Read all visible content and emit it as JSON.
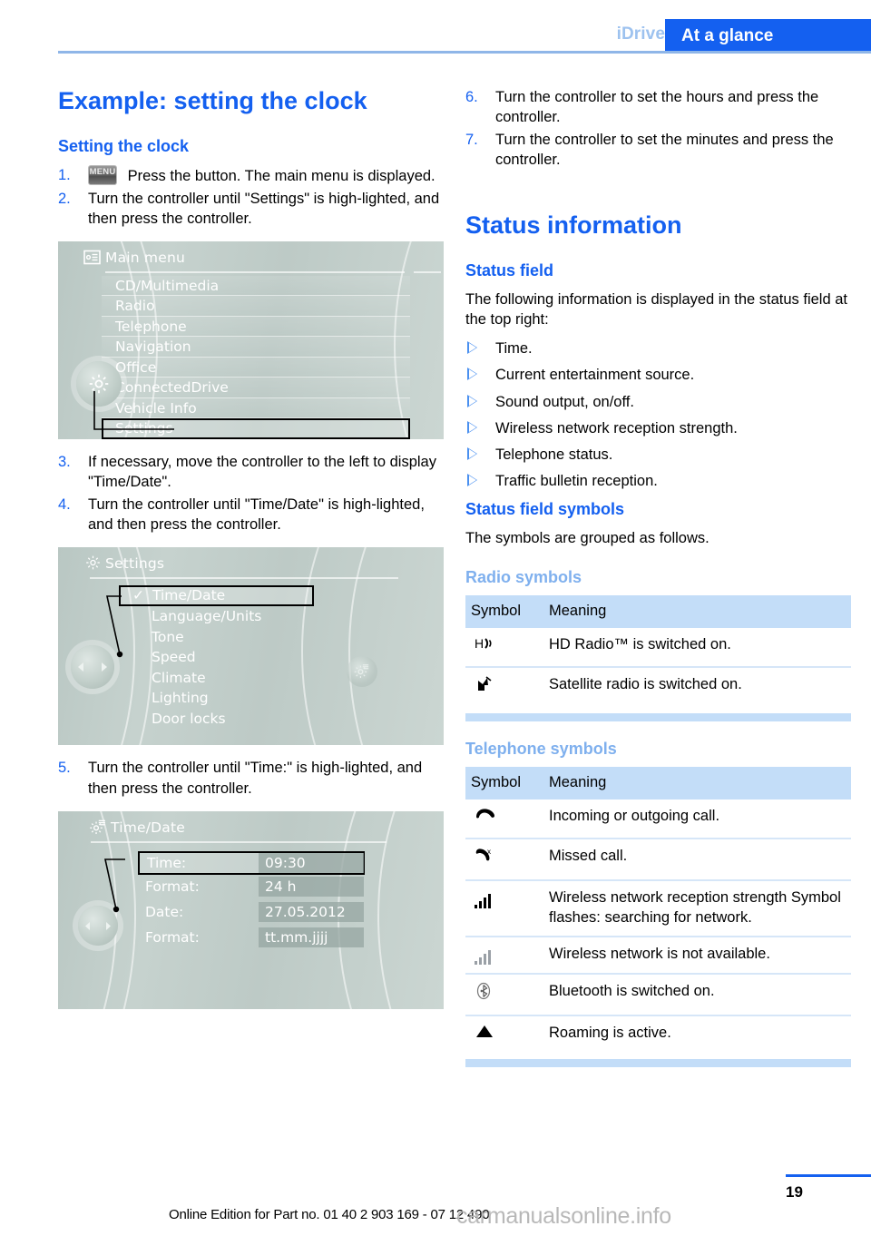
{
  "header": {
    "chapter": "iDrive",
    "section": "At a glance"
  },
  "left": {
    "title": "Example: setting the clock",
    "subheading": "Setting the clock",
    "steps": [
      {
        "num": "1.",
        "icon": "MENU",
        "text": "Press the button. The main menu is displayed."
      },
      {
        "num": "2.",
        "text": "Turn the controller until \"Settings\" is high-lighted, and then press the controller."
      },
      {
        "num": "3.",
        "text": "If necessary, move the controller to the left to display \"Time/Date\"."
      },
      {
        "num": "4.",
        "text": "Turn the controller until \"Time/Date\" is high-lighted, and then press the controller."
      },
      {
        "num": "5.",
        "text": "Turn the controller until \"Time:\" is high-lighted, and then press the controller."
      }
    ],
    "screen_main_menu": {
      "title": "Main menu",
      "title_icon": "list-card-icon",
      "knob_icon": "gear-icon",
      "items": [
        "CD/Multimedia",
        "Radio",
        "Telephone",
        "Navigation",
        "Office",
        "ConnectedDrive",
        "Vehicle Info",
        "Settings"
      ],
      "selected": "Settings"
    },
    "screen_settings": {
      "title": "Settings",
      "title_icon": "gear-icon",
      "knob_icon": "left-right-arrows-icon",
      "side_icon": "settings-gear-icon",
      "check_mark": "✓",
      "items": [
        "Time/Date",
        "Language/Units",
        "Tone",
        "Speed",
        "Climate",
        "Lighting",
        "Door locks"
      ],
      "selected": "Time/Date"
    },
    "screen_time_date": {
      "title": "Time/Date",
      "title_icon": "settings-gear-icon",
      "knob_icon": "left-right-arrows-icon",
      "rows": [
        {
          "label": "Time:",
          "value": "09:30",
          "selected": true
        },
        {
          "label": "Format:",
          "value": "24 h",
          "selected": false
        },
        {
          "label": "Date:",
          "value": "27.05.2012",
          "selected": false
        },
        {
          "label": "Format:",
          "value": "tt.mm.jjjj",
          "selected": false
        }
      ]
    }
  },
  "right": {
    "steps": [
      {
        "num": "6.",
        "text": "Turn the controller to set the hours and press the controller."
      },
      {
        "num": "7.",
        "text": "Turn the controller to set the minutes and press the controller."
      }
    ],
    "title": "Status information",
    "status_field": {
      "heading": "Status field",
      "intro": "The following information is displayed in the status field at the top right:",
      "bullets": [
        "Time.",
        "Current entertainment source.",
        "Sound output, on/off.",
        "Wireless network reception strength.",
        "Telephone status.",
        "Traffic bulletin reception."
      ]
    },
    "status_symbols": {
      "heading": "Status field symbols",
      "intro": "The symbols are grouped as follows."
    },
    "radio_symbols": {
      "heading": "Radio symbols",
      "columns": [
        "Symbol",
        "Meaning"
      ],
      "rows": [
        {
          "symbol": "hd-radio-icon",
          "glyph": "HD))",
          "meaning": "HD Radio™ is switched on."
        },
        {
          "symbol": "satellite-radio-icon",
          "glyph": "satellite",
          "meaning": "Satellite radio is switched on."
        }
      ]
    },
    "telephone_symbols": {
      "heading": "Telephone symbols",
      "columns": [
        "Symbol",
        "Meaning"
      ],
      "rows": [
        {
          "symbol": "phone-handset-icon",
          "glyph": "call",
          "meaning": "Incoming or outgoing call."
        },
        {
          "symbol": "missed-call-icon",
          "glyph": "missed",
          "meaning": "Missed call."
        },
        {
          "symbol": "signal-bars-icon",
          "glyph": "bars",
          "meaning": "Wireless network reception strength Symbol flashes: searching for network."
        },
        {
          "symbol": "signal-bars-unavailable-icon",
          "glyph": "bars-off",
          "meaning": "Wireless network is not available."
        },
        {
          "symbol": "bluetooth-icon",
          "glyph": "bluetooth",
          "meaning": "Bluetooth is switched on."
        },
        {
          "symbol": "roaming-triangle-icon",
          "glyph": "triangle",
          "meaning": "Roaming is active."
        }
      ]
    }
  },
  "footer": {
    "page_number": "19",
    "edition": "Online Edition for Part no. 01 40 2 903 169 - 07 12 490",
    "watermark": "carmanualsonline.info"
  },
  "colors": {
    "accent_blue": "#1460f0",
    "light_blue": "#7fb0ee",
    "table_header": "#c3ddf8",
    "screen_bg": "#c3cfcb"
  }
}
